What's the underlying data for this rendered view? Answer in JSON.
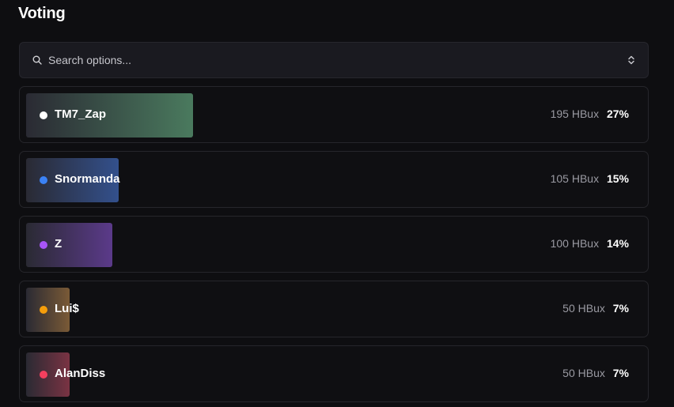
{
  "header": {
    "title": "Voting"
  },
  "search": {
    "placeholder": "Search options...",
    "icon": "search-icon",
    "sort_icon": "chevrons-up-down-icon"
  },
  "options": [
    {
      "name": "TM7_Zap",
      "amount": "195 HBux",
      "percent": "27%",
      "share": 0.27,
      "color": "#ffffff",
      "fill": "#4a7a5e"
    },
    {
      "name": "Snormanda",
      "amount": "105 HBux",
      "percent": "15%",
      "share": 0.15,
      "color": "#3b82f6",
      "fill": "#33508c"
    },
    {
      "name": "Z",
      "amount": "100 HBux",
      "percent": "14%",
      "share": 0.14,
      "color": "#a855f7",
      "fill": "#5b3a8a"
    },
    {
      "name": "Lui$",
      "amount": "50 HBux",
      "percent": "7%",
      "share": 0.07,
      "color": "#f59e0b",
      "fill": "#7a5a36"
    },
    {
      "name": "AlanDiss",
      "amount": "50 HBux",
      "percent": "7%",
      "share": 0.07,
      "color": "#f43f5e",
      "fill": "#7a3343"
    }
  ]
}
